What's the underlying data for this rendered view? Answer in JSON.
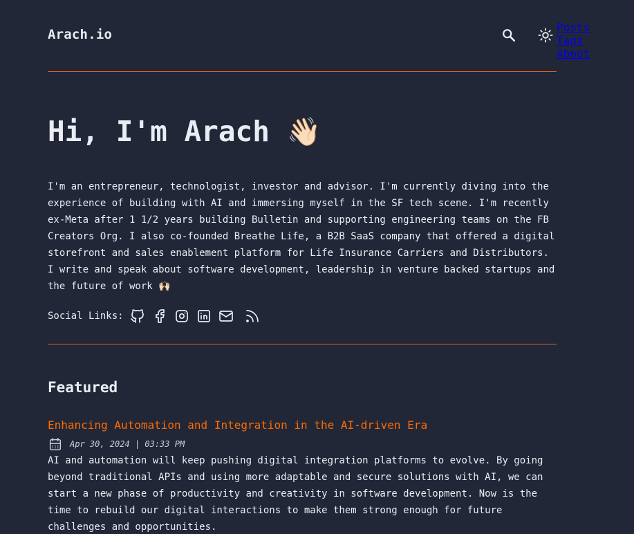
{
  "header": {
    "logo": "Arach.io",
    "nav": {
      "posts": "Posts",
      "tags": "Tags",
      "about": "About",
      "search_icon": "search-icon",
      "theme_icon": "sun-icon"
    }
  },
  "hero": {
    "title": "Hi, I'm Arach",
    "wave_emoji": "👋🏻",
    "intro": "I'm an entrepreneur, technologist, investor and advisor. I'm currently diving into the experience of building with AI and immersing myself in the SF tech scene. I'm recently ex-Meta after 1 1/2 years building Bulletin and supporting engineering teams on the FB Creators Org. I also co-founded Breathe Life, a B2B SaaS company that offered a digital storefront and sales enablement platform for Life Insurance Carriers and Distributors. I write and speak about software development, leadership in venture backed startups and the future of work",
    "intro_emoji": "🙌🏻"
  },
  "social": {
    "label": "Social Links:",
    "icons": [
      "github-icon",
      "facebook-icon",
      "instagram-icon",
      "linkedin-icon",
      "mail-icon",
      "rss-icon"
    ]
  },
  "featured": {
    "heading": "Featured",
    "posts": [
      {
        "title": "Enhancing Automation and Integration in the AI-driven Era",
        "date": "Apr 30, 2024 | 03:33 PM",
        "description": "AI and automation will keep pushing digital integration platforms to evolve. By going beyond traditional APIs and using more adaptable and secure solutions with AI, we can start a new phase of productivity and creativity in software development. Now is the time to rebuild our digital interactions to make them strong enough for future challenges and opportunities."
      }
    ]
  },
  "colors": {
    "background": "#212737",
    "text": "#eaedf3",
    "accent": "#ff6b01",
    "rule": "#d9642b"
  }
}
